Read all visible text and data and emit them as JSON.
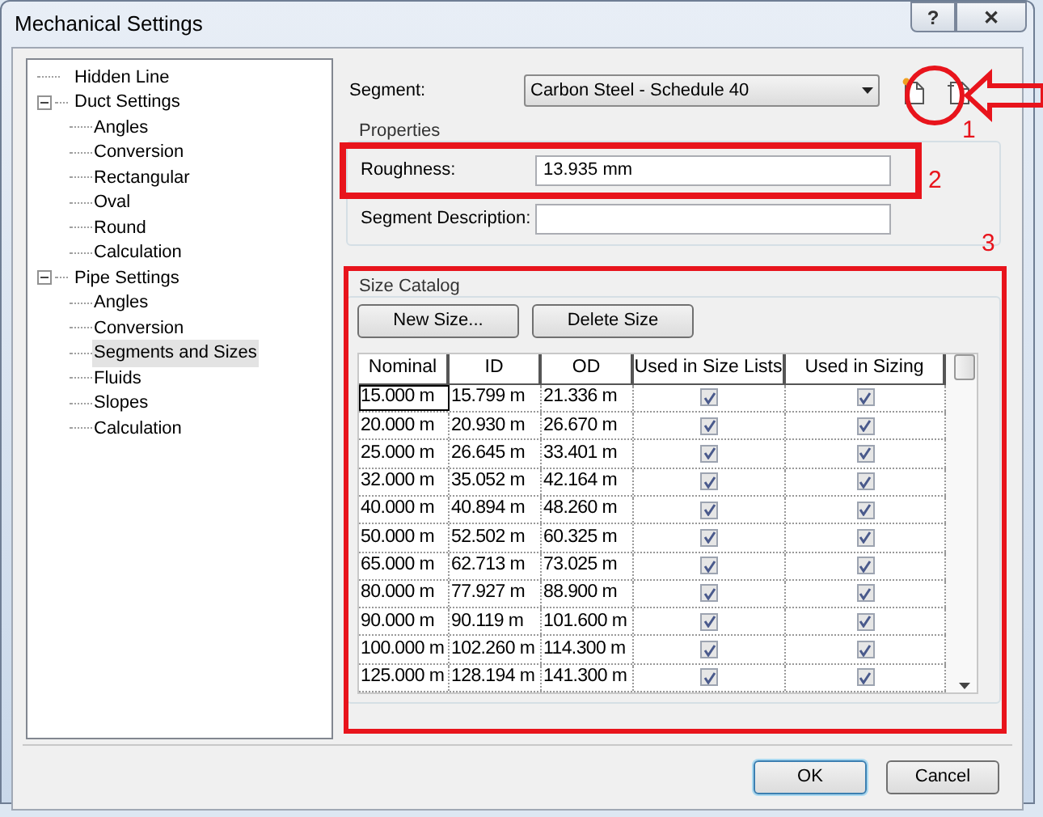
{
  "window": {
    "title": "Mechanical Settings",
    "buttons": [
      "?",
      "✕"
    ]
  },
  "tree": [
    {
      "label": "Hidden Line",
      "selected": false
    },
    {
      "label": "Duct Settings",
      "selected": false,
      "expanded": true,
      "children": [
        {
          "label": "Angles",
          "selected": false
        },
        {
          "label": "Conversion",
          "selected": false
        },
        {
          "label": "Rectangular",
          "selected": false
        },
        {
          "label": "Oval",
          "selected": false
        },
        {
          "label": "Round",
          "selected": false
        },
        {
          "label": "Calculation",
          "selected": false
        }
      ]
    },
    {
      "label": "Pipe Settings",
      "selected": false,
      "expanded": true,
      "children": [
        {
          "label": "Angles",
          "selected": false
        },
        {
          "label": "Conversion",
          "selected": false
        },
        {
          "label": "Segments and Sizes",
          "selected": true
        },
        {
          "label": "Fluids",
          "selected": false
        },
        {
          "label": "Slopes",
          "selected": false
        },
        {
          "label": "Calculation",
          "selected": false
        }
      ]
    }
  ],
  "segment": {
    "label": "Segment:",
    "value": "Carbon Steel - Schedule 40"
  },
  "properties": {
    "title": "Properties",
    "roughness_label": "Roughness:",
    "roughness_value": "13.935 mm",
    "description_label": "Segment Description:"
  },
  "size_catalog": {
    "title": "Size Catalog",
    "buttons": [
      "New Size...",
      "Delete Size"
    ],
    "columns": [
      "Nominal",
      "ID",
      "OD",
      "Used in Size Lists",
      "Used in Sizing"
    ],
    "rows": [
      {
        "nominal": "15.000 m",
        "id": "15.799 m",
        "od": "21.336 m",
        "used_in_size_lists": true,
        "used_in_sizing": true,
        "selected": true
      },
      {
        "nominal": "20.000 m",
        "id": "20.930 m",
        "od": "26.670 m",
        "used_in_size_lists": true,
        "used_in_sizing": true,
        "selected": false
      },
      {
        "nominal": "25.000 m",
        "id": "26.645 m",
        "od": "33.401 m",
        "used_in_size_lists": true,
        "used_in_sizing": true,
        "selected": false
      },
      {
        "nominal": "32.000 m",
        "id": "35.052 m",
        "od": "42.164 m",
        "used_in_size_lists": true,
        "used_in_sizing": true,
        "selected": false
      },
      {
        "nominal": "40.000 m",
        "id": "40.894 m",
        "od": "48.260 m",
        "used_in_size_lists": true,
        "used_in_sizing": true,
        "selected": false
      },
      {
        "nominal": "50.000 m",
        "id": "52.502 m",
        "od": "60.325 m",
        "used_in_size_lists": true,
        "used_in_sizing": true,
        "selected": false
      },
      {
        "nominal": "65.000 m",
        "id": "62.713 m",
        "od": "73.025 m",
        "used_in_size_lists": true,
        "used_in_sizing": true,
        "selected": false
      },
      {
        "nominal": "80.000 m",
        "id": "77.927 m",
        "od": "88.900 m",
        "used_in_size_lists": true,
        "used_in_sizing": true,
        "selected": false
      },
      {
        "nominal": "90.000 m",
        "id": "90.119 m",
        "od": "101.600 m",
        "used_in_size_lists": true,
        "used_in_sizing": true,
        "selected": false
      },
      {
        "nominal": "100.000 m",
        "id": "102.260 m",
        "od": "114.300 m",
        "used_in_size_lists": true,
        "used_in_sizing": true,
        "selected": false
      },
      {
        "nominal": "125.000 m",
        "id": "128.194 m",
        "od": "141.300 m",
        "used_in_size_lists": true,
        "used_in_sizing": true,
        "selected": false
      }
    ]
  },
  "annotations": [
    "1",
    "2",
    "3"
  ],
  "buttons": [
    "OK",
    "Cancel"
  ]
}
